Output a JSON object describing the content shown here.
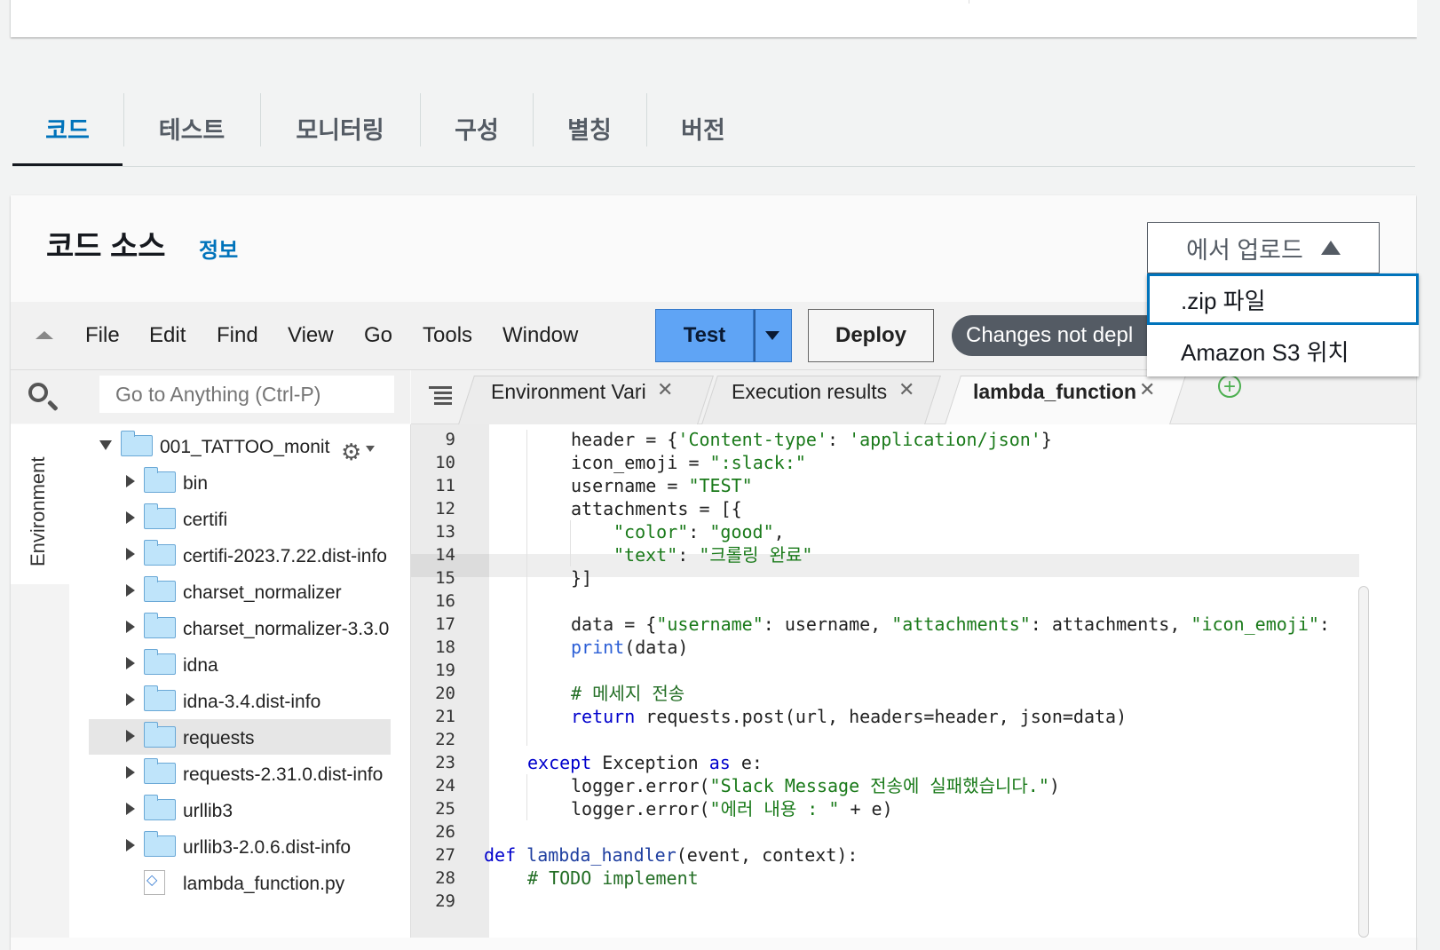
{
  "tabs": [
    "코드",
    "테스트",
    "모니터링",
    "구성",
    "별칭",
    "버전"
  ],
  "panel": {
    "title": "코드 소스",
    "info": "정보"
  },
  "upload": {
    "label": "에서 업로드",
    "options": [
      ".zip 파일",
      "Amazon S3 위치"
    ]
  },
  "ide": {
    "menu": [
      "File",
      "Edit",
      "Find",
      "View",
      "Go",
      "Tools",
      "Window"
    ],
    "test_label": "Test",
    "deploy_label": "Deploy",
    "changes_label": "Changes not depl"
  },
  "sidebar": {
    "search_placeholder": "Go to Anything (Ctrl-P)",
    "env_label": "Environment",
    "root": "001_TATTOO_monit",
    "items": [
      "bin",
      "certifi",
      "certifi-2023.7.22.dist-info",
      "charset_normalizer",
      "charset_normalizer-3.3.0",
      "idna",
      "idna-3.4.dist-info",
      "requests",
      "requests-2.31.0.dist-info",
      "urllib3",
      "urllib3-2.0.6.dist-info"
    ],
    "file": "lambda_function.py"
  },
  "editor_tabs": [
    "Environment Vari",
    "Execution results",
    "lambda_function"
  ],
  "line_numbers": [
    "9",
    "10",
    "11",
    "12",
    "13",
    "14",
    "15",
    "16",
    "17",
    "18",
    "19",
    "20",
    "21",
    "22",
    "23",
    "24",
    "25",
    "26",
    "27",
    "28",
    "29"
  ],
  "code": {
    "l9": {
      "a": "header = {",
      "b": "'Content-type'",
      "c": ": ",
      "d": "'application/json'",
      "e": "}"
    },
    "l10": {
      "a": "icon_emoji = ",
      "b": "\":slack:\""
    },
    "l11": {
      "a": "username = ",
      "b": "\"TEST\""
    },
    "l12": {
      "a": "attachments = [{"
    },
    "l13": {
      "a": "\"color\"",
      "b": ": ",
      "c": "\"good\"",
      "d": ","
    },
    "l14": {
      "a": "\"text\"",
      "b": ": ",
      "c": "\"크롤링 완료\""
    },
    "l15": {
      "a": "}]"
    },
    "l17": {
      "a": "data = {",
      "b": "\"username\"",
      "c": ": username, ",
      "d": "\"attachments\"",
      "e": ": attachments, ",
      "f": "\"icon_emoji\"",
      "g": ":"
    },
    "l18": {
      "a": "print",
      "b": "(data)"
    },
    "l20": {
      "a": "# 메세지 전송"
    },
    "l21": {
      "a": "return",
      "b": " requests.post(url, headers=header, json=data)"
    },
    "l23": {
      "a": "except",
      "b": " Exception ",
      "c": "as",
      "d": " e:"
    },
    "l24": {
      "a": "logger.error(",
      "b": "\"Slack Message 전송에 실패했습니다.\"",
      "c": ")"
    },
    "l25": {
      "a": "logger.error(",
      "b": "\"에러 내용 : \"",
      "c": " + e)"
    },
    "l27": {
      "a": "def",
      "b": " ",
      "c": "lambda_handler",
      "d": "(event, context):"
    },
    "l28": {
      "a": "# TODO implement"
    }
  }
}
